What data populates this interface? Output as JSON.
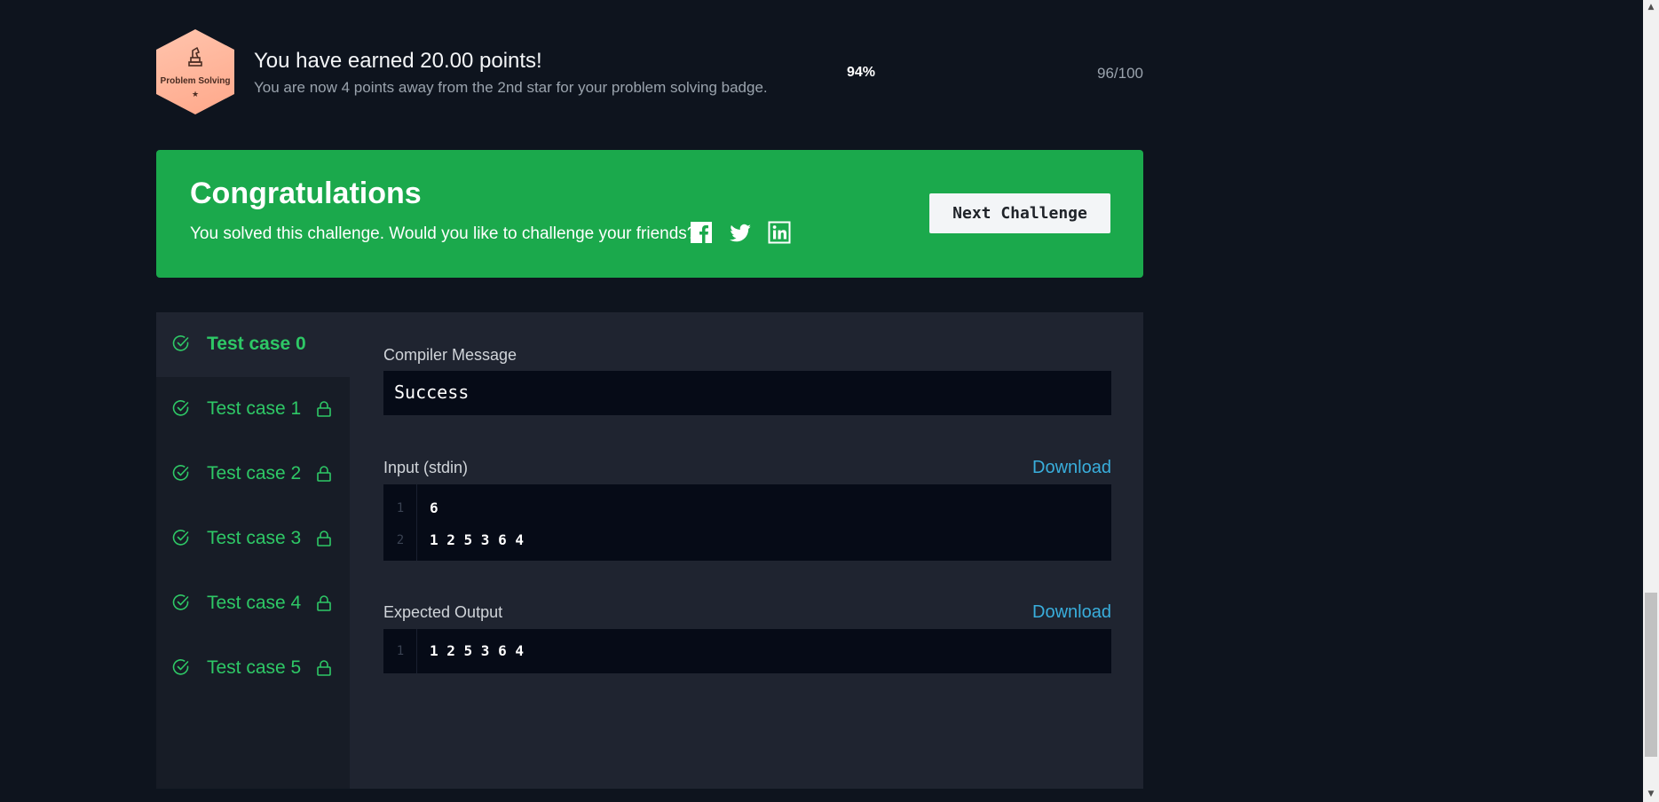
{
  "badge": {
    "label": "Problem Solving",
    "star": "★",
    "earned_title": "You have earned 20.00 points!",
    "earned_subtitle": "You are now 4 points away from the 2nd star for your problem solving badge.",
    "percent_text": "94%",
    "progress_fraction": 0.94,
    "score_text": "96/100"
  },
  "banner": {
    "title": "Congratulations",
    "text": "You solved this challenge. Would you like to challenge your friends?",
    "social_icons": [
      "facebook-icon",
      "twitter-icon",
      "linkedin-icon"
    ],
    "next_button": "Next Challenge",
    "color": "#1ba94c"
  },
  "test_cases": [
    {
      "label": "Test case 0",
      "active": true,
      "locked": false
    },
    {
      "label": "Test case 1",
      "active": false,
      "locked": true
    },
    {
      "label": "Test case 2",
      "active": false,
      "locked": true
    },
    {
      "label": "Test case 3",
      "active": false,
      "locked": true
    },
    {
      "label": "Test case 4",
      "active": false,
      "locked": true
    },
    {
      "label": "Test case 5",
      "active": false,
      "locked": true
    }
  ],
  "result": {
    "compiler_label": "Compiler Message",
    "compiler_message": "Success",
    "input_label": "Input (stdin)",
    "input_download": "Download",
    "input_lines": [
      {
        "n": "1",
        "text": "6"
      },
      {
        "n": "2",
        "text": "1 2 5 3 6 4"
      }
    ],
    "expected_label": "Expected Output",
    "expected_download": "Download",
    "expected_lines": [
      {
        "n": "1",
        "text": "1 2 5 3 6 4"
      }
    ]
  },
  "colors": {
    "background": "#0e141e",
    "success_green": "#2ec866",
    "link_blue": "#39aedc"
  }
}
